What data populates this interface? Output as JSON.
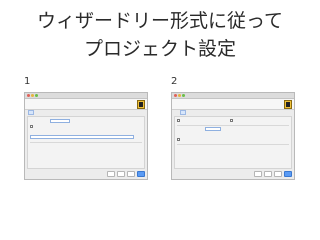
{
  "slide": {
    "title_line1": "ウィザードリー形式に従って",
    "title_line2": "プロジェクト設定"
  },
  "steps": [
    {
      "number": "1",
      "window_title": "",
      "header_title": "",
      "header_subtitle": "",
      "tabs": [
        "",
        "",
        ""
      ],
      "rows": [
        "",
        "",
        "",
        "",
        ""
      ],
      "buttons": [
        "",
        "",
        "",
        ""
      ]
    },
    {
      "number": "2",
      "window_title": "",
      "header_title": "",
      "header_subtitle": "",
      "tabs": [
        "",
        "",
        ""
      ],
      "rows": [
        "",
        "",
        "",
        "",
        "",
        ""
      ],
      "buttons": [
        "",
        "",
        "",
        ""
      ]
    }
  ],
  "colors": {
    "accent_field": "#8fb0e0",
    "primary_button": "#5a9bf5",
    "logo": "#f0c23a"
  }
}
